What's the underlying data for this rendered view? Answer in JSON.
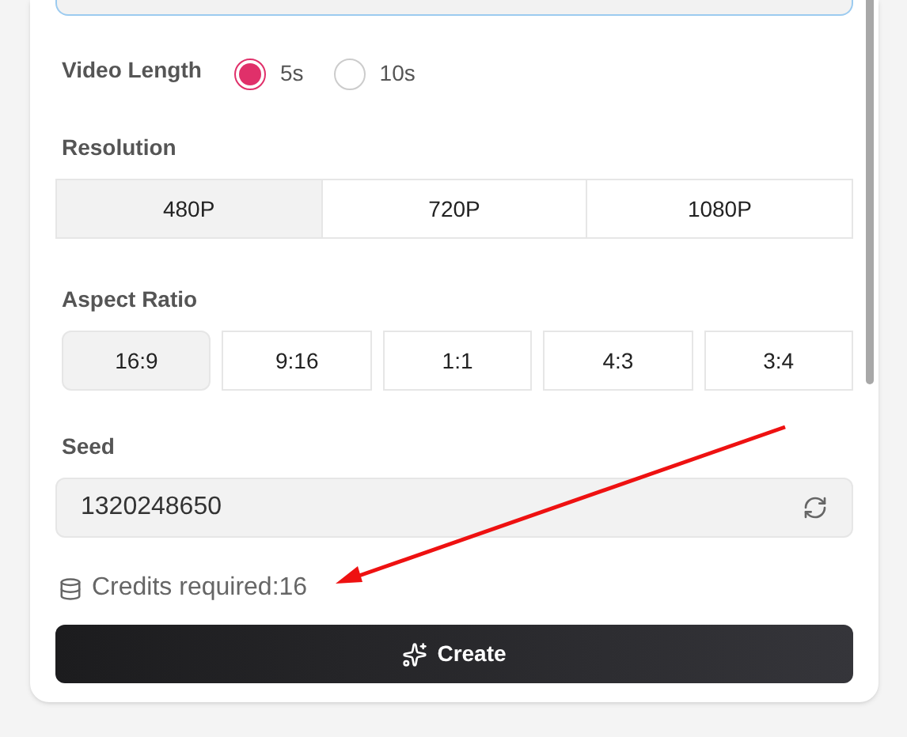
{
  "video_length": {
    "label": "Video Length",
    "options": [
      {
        "label": "5s",
        "selected": true
      },
      {
        "label": "10s",
        "selected": false
      }
    ]
  },
  "resolution": {
    "label": "Resolution",
    "options": [
      {
        "label": "480P",
        "selected": true
      },
      {
        "label": "720P",
        "selected": false
      },
      {
        "label": "1080P",
        "selected": false
      }
    ]
  },
  "aspect_ratio": {
    "label": "Aspect Ratio",
    "options": [
      {
        "label": "16:9",
        "selected": true
      },
      {
        "label": "9:16",
        "selected": false
      },
      {
        "label": "1:1",
        "selected": false
      },
      {
        "label": "4:3",
        "selected": false
      },
      {
        "label": "3:4",
        "selected": false
      }
    ]
  },
  "seed": {
    "label": "Seed",
    "value": "1320248650"
  },
  "credits": {
    "text": "Credits required:16"
  },
  "create_button": {
    "label": "Create"
  }
}
